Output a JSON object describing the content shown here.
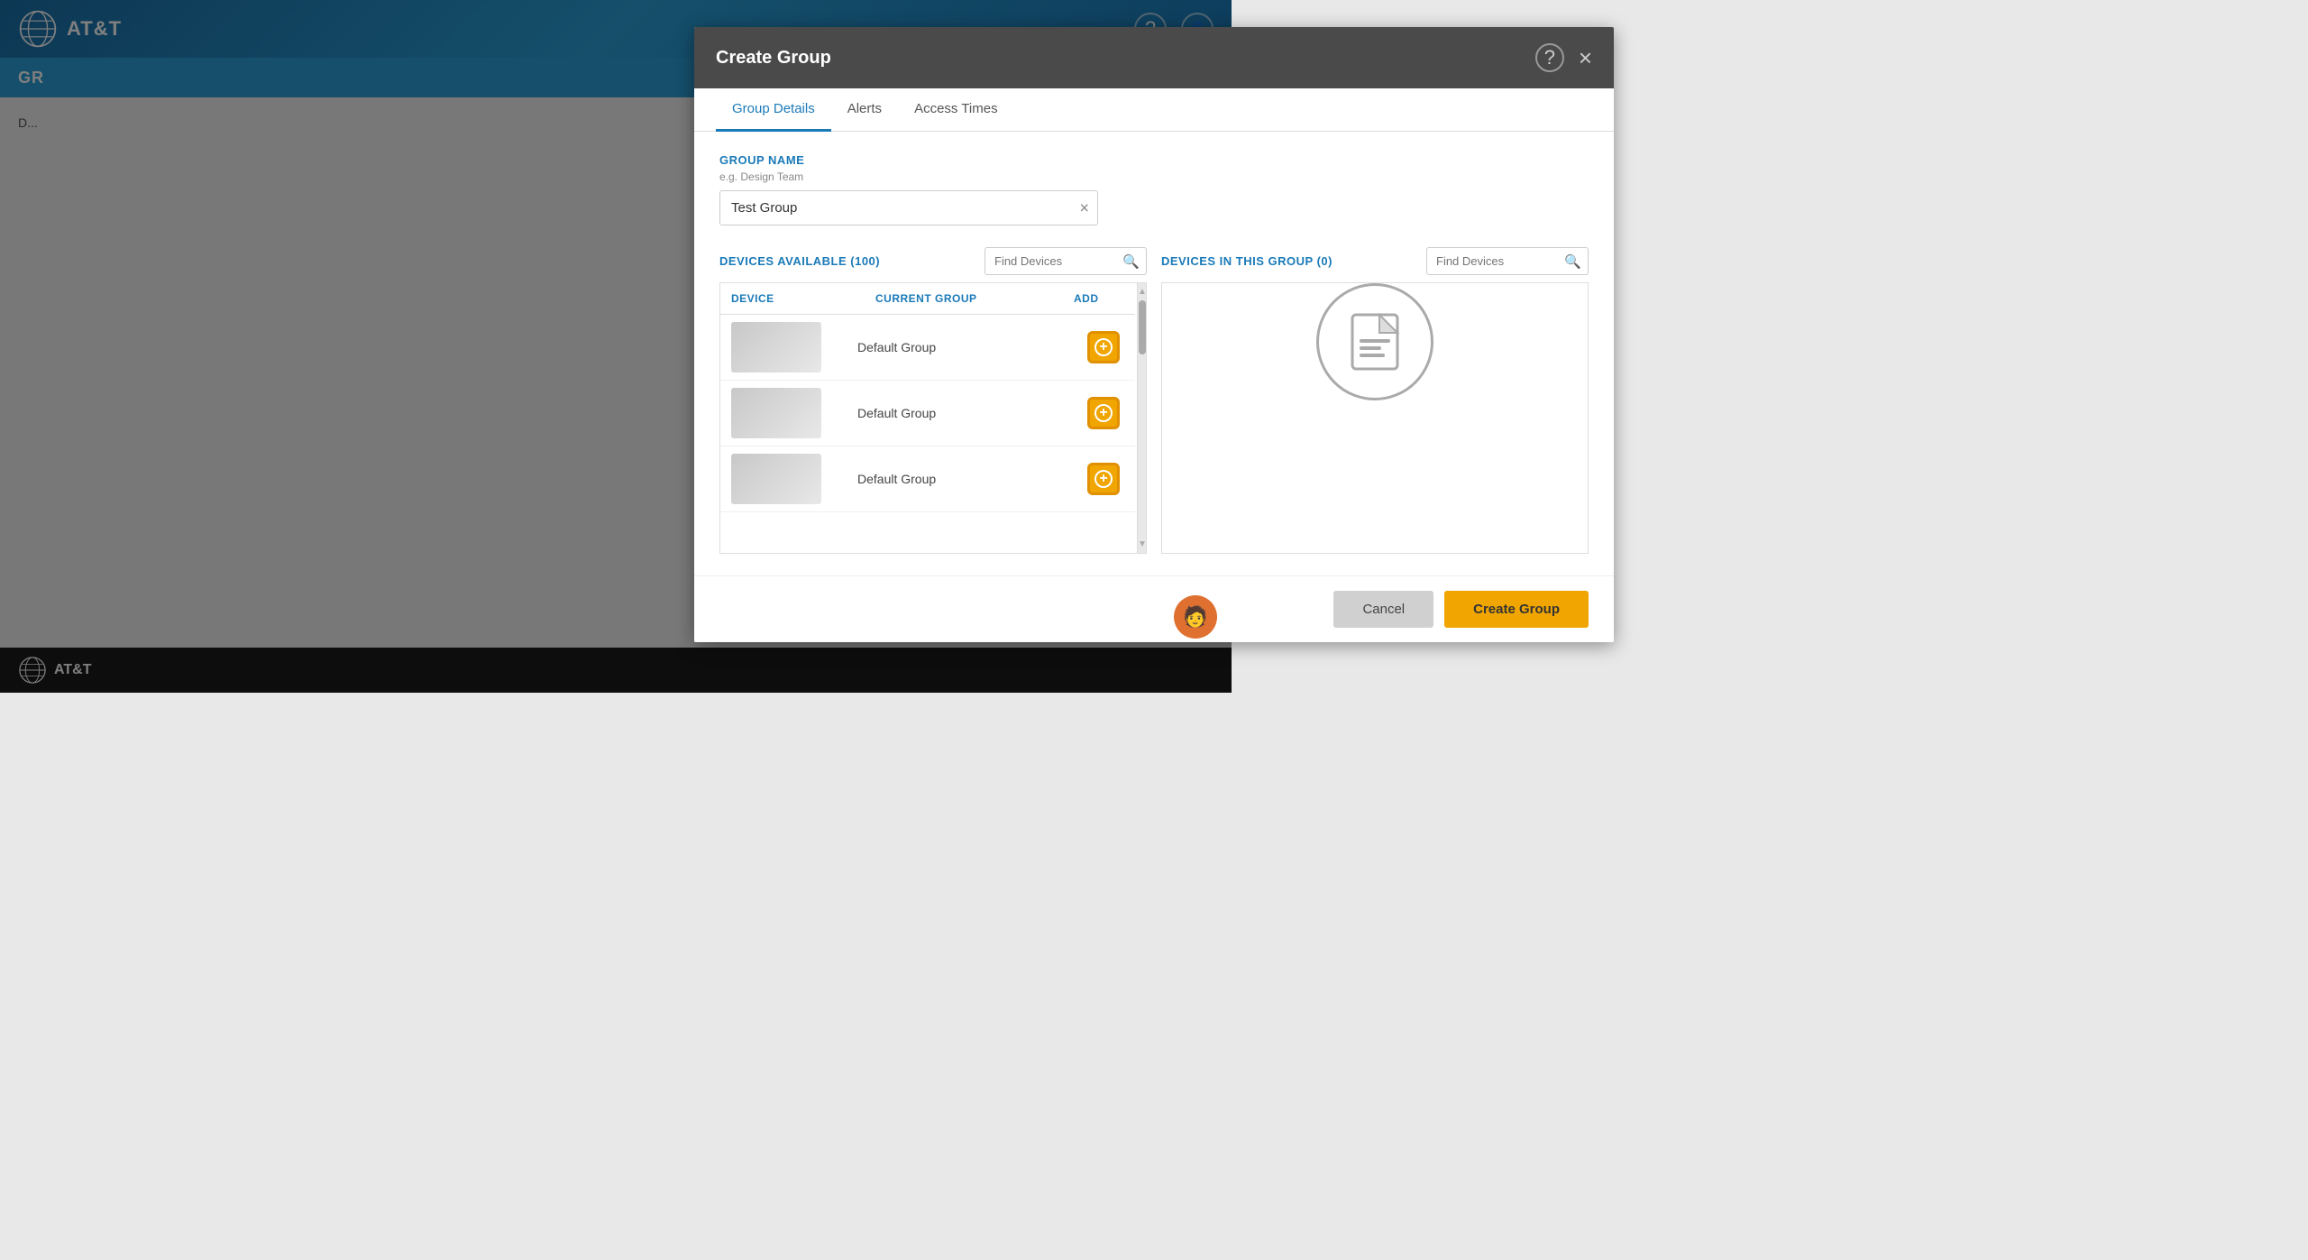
{
  "app": {
    "title": "AT&T",
    "bottom_text": "AT&T"
  },
  "topnav": {
    "logo_text": "AT&T",
    "help_icon": "?",
    "user_icon": "👤"
  },
  "page": {
    "header_title": "GR",
    "add_icon": "+"
  },
  "modal": {
    "title": "Create Group",
    "help_icon": "?",
    "close_icon": "×",
    "tabs": [
      {
        "id": "group-details",
        "label": "Group Details",
        "active": true
      },
      {
        "id": "alerts",
        "label": "Alerts",
        "active": false
      },
      {
        "id": "access-times",
        "label": "Access Times",
        "active": false
      }
    ],
    "group_name_label": "GROUP NAME",
    "group_name_hint": "e.g. Design Team",
    "group_name_value": "Test Group",
    "group_name_clear": "×",
    "devices_available_label": "DEVICES AVAILABLE (100)",
    "find_devices_placeholder": "Find Devices",
    "devices_in_group_label": "DEVICES IN THIS GROUP (0)",
    "find_devices_right_placeholder": "Find Devices",
    "table_headers": {
      "device": "DEVICE",
      "current_group": "CURRENT GROUP",
      "add": "ADD"
    },
    "devices": [
      {
        "group": "Default Group"
      },
      {
        "group": "Default Group"
      },
      {
        "group": "Default Group"
      }
    ],
    "cancel_label": "Cancel",
    "create_group_label": "Create Group"
  },
  "colors": {
    "brand_blue": "#1a7ab8",
    "brand_orange": "#f0a500",
    "header_bg": "#4a4a4a",
    "tab_active": "#1a7ab8",
    "button_create": "#f0a500"
  }
}
